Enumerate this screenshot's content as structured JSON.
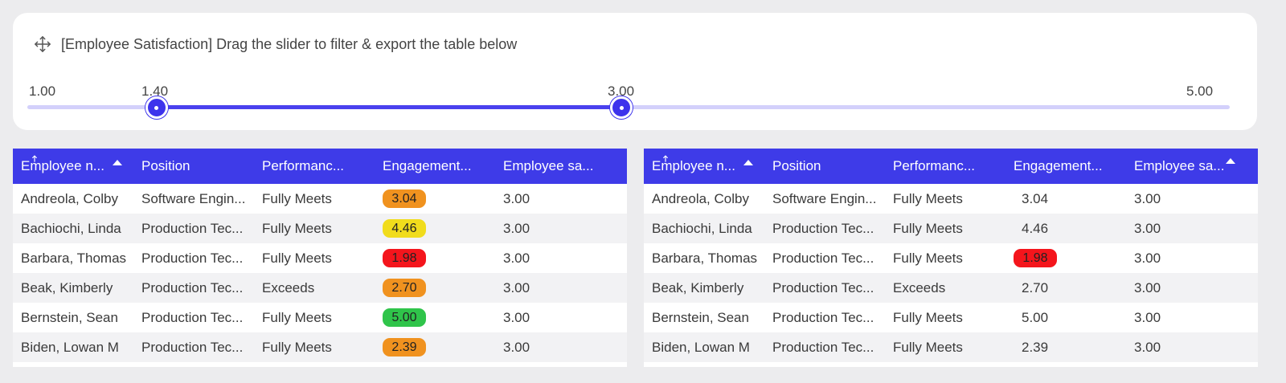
{
  "card": {
    "title": "[Employee Satisfaction] Drag the slider to filter & export the table below",
    "icon": "move-icon"
  },
  "slider": {
    "min_label": "1.00",
    "low_label": "1.40",
    "high_label": "3.00",
    "max_label": "5.00",
    "min": 1.0,
    "max": 5.0,
    "low": 1.4,
    "high": 3.0,
    "track_color": "#d3d0fb",
    "fill_color": "#4a41ee"
  },
  "colors": {
    "header_bg": "#3e3be8",
    "pill_orange": "#f0921f",
    "pill_yellow": "#f1dc1c",
    "pill_red": "#f4151c",
    "pill_green": "#2fc44a"
  },
  "table_left": {
    "headers": [
      "Employee n...",
      "Position",
      "Performanc...",
      "Engagement...",
      "Employee sa..."
    ],
    "rows": [
      {
        "name": "Andreola, Colby",
        "position": "Software Engin...",
        "performance": "Fully Meets",
        "engagement": "3.04",
        "pill": "#f0921f",
        "satisfaction": "3.00"
      },
      {
        "name": "Bachiochi, Linda",
        "position": "Production Tec...",
        "performance": "Fully Meets",
        "engagement": "4.46",
        "pill": "#f1dc1c",
        "satisfaction": "3.00"
      },
      {
        "name": "Barbara, Thomas",
        "position": "Production Tec...",
        "performance": "Fully Meets",
        "engagement": "1.98",
        "pill": "#f4151c",
        "satisfaction": "3.00"
      },
      {
        "name": "Beak, Kimberly",
        "position": "Production Tec...",
        "performance": "Exceeds",
        "engagement": "2.70",
        "pill": "#f0921f",
        "satisfaction": "3.00"
      },
      {
        "name": "Bernstein, Sean",
        "position": "Production Tec...",
        "performance": "Fully Meets",
        "engagement": "5.00",
        "pill": "#2fc44a",
        "satisfaction": "3.00"
      },
      {
        "name": "Biden, Lowan M",
        "position": "Production Tec...",
        "performance": "Fully Meets",
        "engagement": "2.39",
        "pill": "#f0921f",
        "satisfaction": "3.00"
      }
    ]
  },
  "table_right": {
    "headers": [
      "Employee n...",
      "Position",
      "Performanc...",
      "Engagement...",
      "Employee sa..."
    ],
    "rows": [
      {
        "name": "Andreola, Colby",
        "position": "Software Engin...",
        "performance": "Fully Meets",
        "engagement": "3.04",
        "pill": "",
        "satisfaction": "3.00"
      },
      {
        "name": "Bachiochi, Linda",
        "position": "Production Tec...",
        "performance": "Fully Meets",
        "engagement": "4.46",
        "pill": "",
        "satisfaction": "3.00"
      },
      {
        "name": "Barbara, Thomas",
        "position": "Production Tec...",
        "performance": "Fully Meets",
        "engagement": "1.98",
        "pill": "#f4151c",
        "satisfaction": "3.00"
      },
      {
        "name": "Beak, Kimberly",
        "position": "Production Tec...",
        "performance": "Exceeds",
        "engagement": "2.70",
        "pill": "",
        "satisfaction": "3.00"
      },
      {
        "name": "Bernstein, Sean",
        "position": "Production Tec...",
        "performance": "Fully Meets",
        "engagement": "5.00",
        "pill": "",
        "satisfaction": "3.00"
      },
      {
        "name": "Biden, Lowan M",
        "position": "Production Tec...",
        "performance": "Fully Meets",
        "engagement": "2.39",
        "pill": "",
        "satisfaction": "3.00"
      }
    ]
  }
}
